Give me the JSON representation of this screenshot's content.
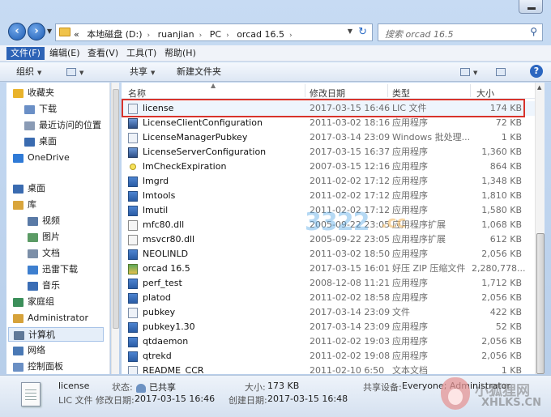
{
  "address": {
    "crumbs": [
      "«",
      "本地磁盘 (D:)",
      "ruanjian",
      "PC",
      "orcad 16.5"
    ],
    "separator": "›"
  },
  "search": {
    "placeholder": "搜索 orcad 16.5"
  },
  "menu": [
    "文件(F)",
    "编辑(E)",
    "查看(V)",
    "工具(T)",
    "帮助(H)"
  ],
  "toolbar": {
    "organize": "组织",
    "share": "共享",
    "new_folder": "新建文件夹"
  },
  "nav": {
    "items": [
      {
        "label": "收藏夹",
        "icon": "favorites-star-icon",
        "color": "#e9b32b"
      },
      {
        "label": "下载",
        "icon": "downloads-folder-icon",
        "color": "#6a8fc6"
      },
      {
        "label": "最近访问的位置",
        "icon": "recent-places-icon",
        "color": "#8a9bb5"
      },
      {
        "label": "桌面",
        "icon": "desktop-icon",
        "color": "#3a6bb0"
      },
      {
        "label": "OneDrive",
        "icon": "onedrive-cloud-icon",
        "color": "#2f7ad6"
      },
      {
        "label": "桌面",
        "icon": "desktop-icon",
        "color": "#3a6bb0"
      },
      {
        "label": "库",
        "icon": "libraries-icon",
        "color": "#d9a53c"
      },
      {
        "label": "视频",
        "icon": "videos-icon",
        "color": "#5a7aa6"
      },
      {
        "label": "图片",
        "icon": "pictures-icon",
        "color": "#5b9b65"
      },
      {
        "label": "文档",
        "icon": "documents-icon",
        "color": "#7c8fa8"
      },
      {
        "label": "迅雷下载",
        "icon": "thunder-download-icon",
        "color": "#3d7fcf"
      },
      {
        "label": "音乐",
        "icon": "music-note-icon",
        "color": "#3a6db5"
      },
      {
        "label": "家庭组",
        "icon": "homegroup-icon",
        "color": "#3c8f5a"
      },
      {
        "label": "Administrator",
        "icon": "user-folder-icon",
        "color": "#d6a23a"
      },
      {
        "label": "计算机",
        "icon": "computer-icon",
        "color": "#5f7898"
      },
      {
        "label": "网络",
        "icon": "network-icon",
        "color": "#4a79b5"
      },
      {
        "label": "控制面板",
        "icon": "control-panel-icon",
        "color": "#6a8fc4"
      }
    ]
  },
  "columns": {
    "name": "名称",
    "date": "修改日期",
    "type": "类型",
    "size": "大小"
  },
  "files": [
    {
      "name": "license",
      "date": "2017-03-15 16:46",
      "type": "LIC 文件",
      "size": "174 KB",
      "icon": "doc-file-icon",
      "kind": "doc"
    },
    {
      "name": "LicenseClientConfiguration",
      "date": "2011-03-02 18:16",
      "type": "应用程序",
      "size": "72 KB",
      "icon": "gear-app-icon",
      "kind": "gear"
    },
    {
      "name": "LicenseManagerPubkey",
      "date": "2017-03-14 23:09",
      "type": "Windows 批处理...",
      "size": "1 KB",
      "icon": "batch-file-icon",
      "kind": "doc"
    },
    {
      "name": "LicenseServerConfiguration",
      "date": "2017-03-15 16:37",
      "type": "应用程序",
      "size": "1,360 KB",
      "icon": "gear-app-icon",
      "kind": "gear"
    },
    {
      "name": "lmCheckExpiration",
      "date": "2007-03-15 12:16",
      "type": "应用程序",
      "size": "864 KB",
      "icon": "yellow-dot-icon",
      "kind": "exp"
    },
    {
      "name": "lmgrd",
      "date": "2011-02-02 17:12",
      "type": "应用程序",
      "size": "1,348 KB",
      "icon": "app-icon",
      "kind": "app"
    },
    {
      "name": "lmtools",
      "date": "2011-02-02 17:12",
      "type": "应用程序",
      "size": "1,810 KB",
      "icon": "app-icon",
      "kind": "app"
    },
    {
      "name": "lmutil",
      "date": "2011-02-02 17:12",
      "type": "应用程序",
      "size": "1,580 KB",
      "icon": "app-icon",
      "kind": "app"
    },
    {
      "name": "mfc80.dll",
      "date": "2005-09-22 23:05",
      "type": "应用程序扩展",
      "size": "1,068 KB",
      "icon": "dll-file-icon",
      "kind": "dll"
    },
    {
      "name": "msvcr80.dll",
      "date": "2005-09-22 23:05",
      "type": "应用程序扩展",
      "size": "612 KB",
      "icon": "dll-file-icon",
      "kind": "dll"
    },
    {
      "name": "NEOLINLD",
      "date": "2011-03-02 18:50",
      "type": "应用程序",
      "size": "2,056 KB",
      "icon": "app-icon",
      "kind": "app"
    },
    {
      "name": "orcad 16.5",
      "date": "2017-03-15 16:01",
      "type": "好压 ZIP 压缩文件",
      "size": "2,280,778...",
      "icon": "zip-archive-icon",
      "kind": "zip"
    },
    {
      "name": "perf_test",
      "date": "2008-12-08 11:21",
      "type": "应用程序",
      "size": "1,712 KB",
      "icon": "app-icon",
      "kind": "app"
    },
    {
      "name": "platod",
      "date": "2011-02-02 18:58",
      "type": "应用程序",
      "size": "2,056 KB",
      "icon": "app-icon",
      "kind": "app"
    },
    {
      "name": "pubkey",
      "date": "2017-03-14 23:09",
      "type": "文件",
      "size": "422 KB",
      "icon": "blank-file-icon",
      "kind": "doc"
    },
    {
      "name": "pubkey1.30",
      "date": "2017-03-14 23:09",
      "type": "应用程序",
      "size": "52 KB",
      "icon": "app-icon",
      "kind": "app"
    },
    {
      "name": "qtdaemon",
      "date": "2011-02-02 19:03",
      "type": "应用程序",
      "size": "2,056 KB",
      "icon": "app-icon",
      "kind": "app"
    },
    {
      "name": "qtrekd",
      "date": "2011-02-02 19:08",
      "type": "应用程序",
      "size": "2,056 KB",
      "icon": "app-icon",
      "kind": "app"
    },
    {
      "name": "README_CCR",
      "date": "2011-02-10 6:50",
      "type": "文本文档",
      "size": "1 KB",
      "icon": "text-file-icon",
      "kind": "doc"
    }
  ],
  "details": {
    "name": "license",
    "type": "LIC 文件",
    "status_label": "状态:",
    "status_value": "已共享",
    "modified_label": "修改日期:",
    "modified_value": "2017-03-15 16:46",
    "size_label": "大小:",
    "size_value": "173 KB",
    "created_label": "创建日期:",
    "created_value": "2017-03-15 16:48",
    "shared_label": "共享设备:",
    "shared_value": "Everyone; Administrator"
  },
  "watermarks": {
    "site_num": "3322",
    "site_tld": ".cc",
    "fox_cn": "小狐狸网",
    "fox_en": "XHLKS.CN"
  }
}
